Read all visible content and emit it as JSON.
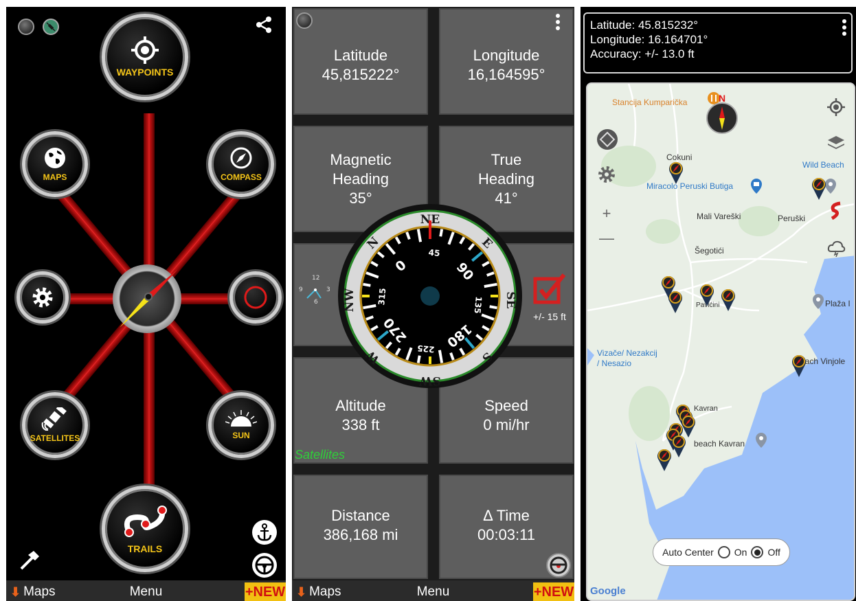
{
  "panel1": {
    "waypoints_label": "WAYPOINTS",
    "maps_label": "MAPS",
    "compass_label": "COMPASS",
    "satellites_label": "SATELLITES",
    "sun_label": "SUN",
    "trails_label": "TRAILS"
  },
  "panel2": {
    "latitude_label": "Latitude",
    "latitude_value": "45,815222°",
    "longitude_label": "Longitude",
    "longitude_value": "16,164595°",
    "magnetic_label_1": "Magnetic",
    "magnetic_label_2": "Heading",
    "magnetic_value": "35°",
    "true_label_1": "True",
    "true_label_2": "Heading",
    "true_value": "41°",
    "accuracy": "+/- 15 ft",
    "satellites_text": "Satellites",
    "altitude_label": "Altitude",
    "altitude_value": "338 ft",
    "speed_label": "Speed",
    "speed_value": "0 mi/hr",
    "distance_label": "Distance",
    "distance_value": "386,168 mi",
    "time_label": "Δ Time",
    "time_value": "00:03:11",
    "compass_dial": {
      "ring_labels": [
        "NE",
        "E",
        "SE",
        "S",
        "SW",
        "W",
        "NW",
        "N"
      ],
      "degree_labels": [
        "0",
        "45",
        "90",
        "135",
        "180",
        "225",
        "270",
        "315"
      ]
    },
    "clock_numbers": [
      "12",
      "3",
      "6",
      "9"
    ]
  },
  "panel3": {
    "latitude_line": "Latitude: 45.815232°",
    "longitude_line": "Longitude:  16.164701°",
    "accuracy_line": "Accuracy:  +/- 13.0 ft",
    "places": {
      "stancija": "Stancija Kumparička",
      "cokuni": "Cokuni",
      "miracolo": "Miracolo Peruski Butiga",
      "wild_beach": "Wild Beach",
      "mali_vareski": "Mali Vareški",
      "peruski": "Peruški",
      "segotici": "Šegotići",
      "pavicini": "Pavićini",
      "plaza": "Plaža I",
      "vizace_1": "Vizače/ Nezakcij",
      "vizace_2": "/ Nesazio",
      "beach_vinjole": "Beach Vinjole",
      "kavran": "Kavran",
      "beach_kavran": "beach Kavran"
    },
    "map_compass_letter": "N",
    "auto_center_label": "Auto Center",
    "on_label": "On",
    "off_label": "Off",
    "google_label": "Google",
    "colors": {
      "water": "#9cc0f9",
      "land": "#e9efe6",
      "accent_orange": "#d9822b"
    }
  },
  "bottom_bar": {
    "maps_label": "Maps",
    "menu_label": "Menu",
    "new_label": "+NEW"
  }
}
